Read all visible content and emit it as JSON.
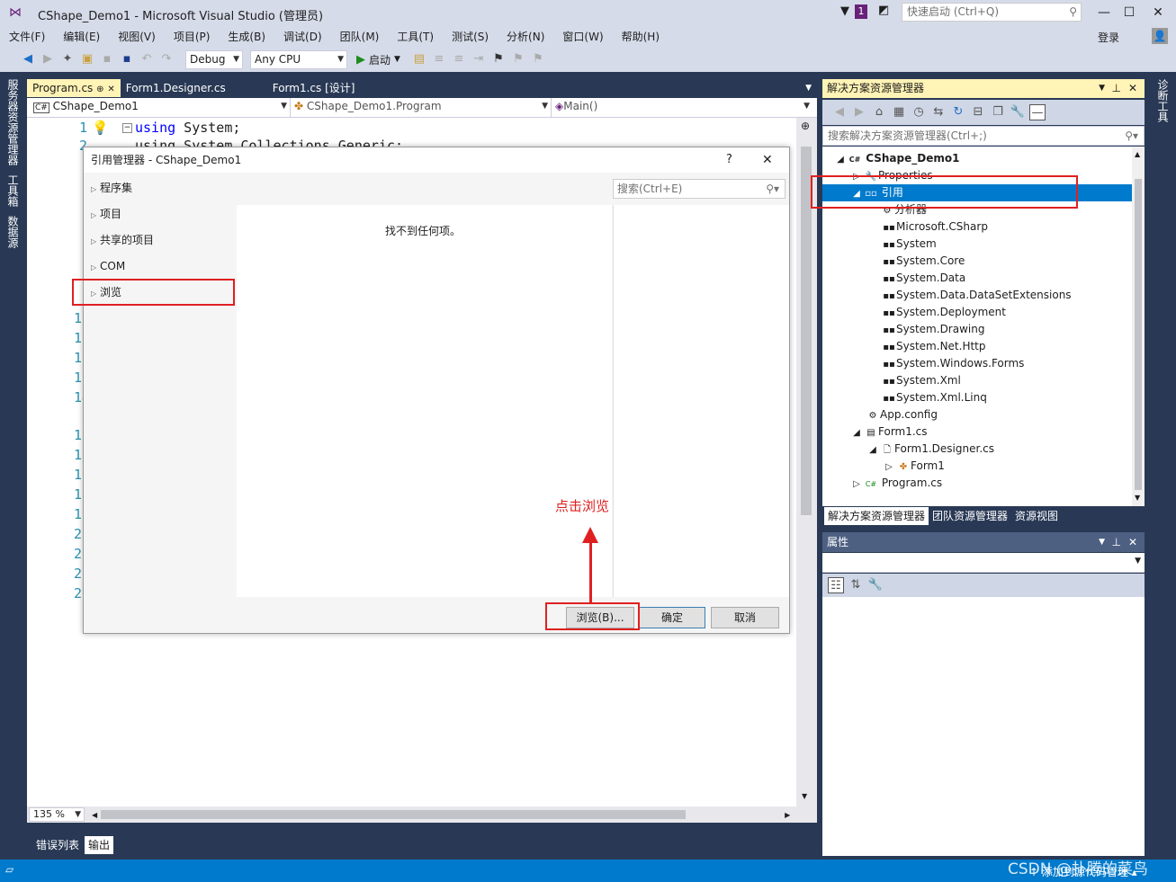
{
  "window": {
    "title": "CShape_Demo1 - Microsoft Visual Studio (管理员)",
    "notif_count": "1",
    "quick_launch_placeholder": "快速启动 (Ctrl+Q)",
    "login": "登录"
  },
  "menu": [
    "文件(F)",
    "编辑(E)",
    "视图(V)",
    "项目(P)",
    "生成(B)",
    "调试(D)",
    "团队(M)",
    "工具(T)",
    "测试(S)",
    "分析(N)",
    "窗口(W)",
    "帮助(H)"
  ],
  "toolbar": {
    "config": "Debug",
    "platform": "Any CPU",
    "start": "启动"
  },
  "left_vtabs": [
    "服务器资源管理器",
    "工具箱",
    "数据源"
  ],
  "right_vtabs": [
    "诊断工具"
  ],
  "doc_tabs": [
    "Program.cs",
    "Form1.Designer.cs",
    "Form1.cs [设计]"
  ],
  "navbar": {
    "project": "CShape_Demo1",
    "class": "CShape_Demo1.Program",
    "member": "Main()"
  },
  "editor": {
    "line1_num": "1",
    "line1_kw": "using",
    "line1_rest": " System;",
    "line2_num": "2",
    "line2_code": "using System.Collections.Generic;",
    "line_numbers": [
      "10",
      "11",
      "12",
      "13",
      "14",
      "15",
      "16",
      "17",
      "18",
      "19",
      "20",
      "21",
      "22",
      "23"
    ],
    "zoom": "135 %"
  },
  "bottom_tabs": [
    "错误列表",
    "输出"
  ],
  "dialog": {
    "title": "引用管理器 - CShape_Demo1",
    "help": "?",
    "close": "✕",
    "search_placeholder": "搜索(Ctrl+E)",
    "categories": [
      "程序集",
      "项目",
      "共享的项目",
      "COM",
      "浏览"
    ],
    "empty_message": "找不到任何项。",
    "buttons": {
      "browse": "浏览(B)...",
      "ok": "确定",
      "cancel": "取消"
    },
    "annotation": "点击浏览"
  },
  "solution_explorer": {
    "title": "解决方案资源管理器",
    "search_placeholder": "搜索解决方案资源管理器(Ctrl+;)",
    "tree": {
      "project": "CShape_Demo1",
      "properties": "Properties",
      "references": "引用",
      "analyzers": "分析器",
      "refs": [
        "Microsoft.CSharp",
        "System",
        "System.Core",
        "System.Data",
        "System.Data.DataSetExtensions",
        "System.Deployment",
        "System.Drawing",
        "System.Net.Http",
        "System.Windows.Forms",
        "System.Xml",
        "System.Xml.Linq"
      ],
      "app_config": "App.config",
      "form1": "Form1.cs",
      "form1_designer": "Form1.Designer.cs",
      "form1_class": "Form1",
      "program": "Program.cs"
    },
    "tabs": [
      "解决方案资源管理器",
      "团队资源管理器",
      "资源视图"
    ]
  },
  "properties": {
    "title": "属性"
  },
  "status": {
    "right": "↑ 添加到源代码管理 ▴",
    "watermark": "CSDN @扑腾的菜鸟"
  },
  "colors": {
    "accent": "#007acc",
    "highlight": "#e02020",
    "annotation_text": "#e02020"
  }
}
